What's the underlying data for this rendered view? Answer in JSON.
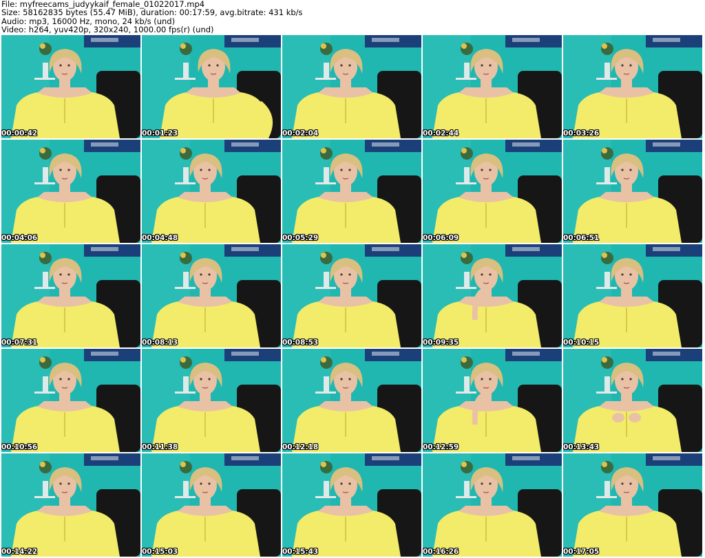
{
  "header": {
    "file_line": "File: myfreecams_judyykaif_female_01022017.mp4",
    "size_line": "Size: 58162835 bytes (55.47 MiB), duration: 00:17:59, avg.bitrate: 431 kb/s",
    "audio_line": "Audio: mp3, 16000 Hz, mono, 24 kb/s (und)",
    "video_line": "Video: h264, yuv420p, 320x240, 1000.00 fps(r) (und)"
  },
  "colors": {
    "wall": "#1fb7b0",
    "wall_light": "#3cc9c0",
    "shirt": "#f2ec6a",
    "skin": "#e9c2a6",
    "hair": "#d9bf80",
    "chair": "#161616",
    "poster": "#1b3f78"
  },
  "thumbnails": [
    {
      "time": "00:00:42",
      "pose": "center"
    },
    {
      "time": "00:01:23",
      "pose": "right-arm"
    },
    {
      "time": "00:02:04",
      "pose": "center"
    },
    {
      "time": "00:02:44",
      "pose": "center"
    },
    {
      "time": "00:03:26",
      "pose": "center"
    },
    {
      "time": "00:04:06",
      "pose": "center"
    },
    {
      "time": "00:04:48",
      "pose": "center"
    },
    {
      "time": "00:05:29",
      "pose": "center"
    },
    {
      "time": "00:06:09",
      "pose": "center"
    },
    {
      "time": "00:06:51",
      "pose": "center"
    },
    {
      "time": "00:07:31",
      "pose": "center"
    },
    {
      "time": "00:08:13",
      "pose": "center"
    },
    {
      "time": "00:08:53",
      "pose": "center"
    },
    {
      "time": "00:09:35",
      "pose": "hand-chin"
    },
    {
      "time": "00:10:15",
      "pose": "center"
    },
    {
      "time": "00:10:56",
      "pose": "center"
    },
    {
      "time": "00:11:38",
      "pose": "center"
    },
    {
      "time": "00:12:18",
      "pose": "center"
    },
    {
      "time": "00:12:59",
      "pose": "hand-chin"
    },
    {
      "time": "00:13:43",
      "pose": "hands-chest"
    },
    {
      "time": "00:14:22",
      "pose": "center"
    },
    {
      "time": "00:15:03",
      "pose": "center"
    },
    {
      "time": "00:15:43",
      "pose": "center"
    },
    {
      "time": "00:16:26",
      "pose": "center"
    },
    {
      "time": "00:17:05",
      "pose": "center"
    }
  ]
}
